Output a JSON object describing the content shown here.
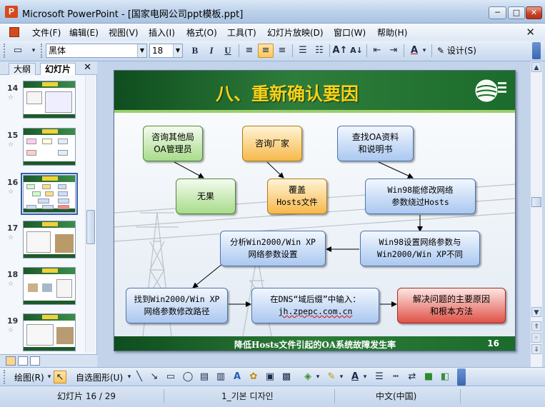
{
  "window": {
    "title": "Microsoft PowerPoint - [国家电网公司ppt模板.ppt]",
    "app_icon_letter": "P",
    "minimize": "─",
    "maximize": "□",
    "close": "✕"
  },
  "menu": {
    "items": [
      "文件(F)",
      "编辑(E)",
      "视图(V)",
      "插入(I)",
      "格式(O)",
      "工具(T)",
      "幻灯片放映(D)",
      "窗口(W)",
      "帮助(H)"
    ],
    "doc_close": "✕"
  },
  "toolbar": {
    "font_name": "黑体",
    "font_size": "18",
    "bold": "B",
    "italic": "I",
    "underline": "U",
    "design_label": "设计(S)"
  },
  "left_pane": {
    "tab_outline": "大纲",
    "tab_slides": "幻灯片",
    "close": "✕",
    "slides": [
      {
        "number": "14"
      },
      {
        "number": "15"
      },
      {
        "number": "16"
      },
      {
        "number": "17"
      },
      {
        "number": "18"
      },
      {
        "number": "19"
      }
    ]
  },
  "slide": {
    "title": "八、重新确认要因",
    "footer": "降低Hosts文件引起的OA系统故障发生率",
    "page": "16",
    "boxes": {
      "consult_other": [
        "咨询其他局",
        "OA管理员"
      ],
      "consult_vendor": [
        "咨询厂家"
      ],
      "find_docs": [
        "查找OA资料",
        "和说明书"
      ],
      "no_result": [
        "无果"
      ],
      "override_hosts": [
        "覆盖",
        "Hosts文件"
      ],
      "win98_modify": [
        "Win98能修改网络",
        "参数绕过Hosts"
      ],
      "analyze_win2000": [
        "分析Win2000/Win XP",
        "网络参数设置"
      ],
      "win98_diff": [
        "Win98设置网络参数与",
        "Win2000/Win XP不同"
      ],
      "find_path": [
        "找到Win2000/Win XP",
        "网络参数修改路径"
      ],
      "dns_input": [
        "在DNS“域后缀”中输入：",
        "jh.zpepc.com.cn"
      ],
      "root_cause": [
        "解决问题的主要原因",
        "和根本方法"
      ]
    }
  },
  "draw_toolbar": {
    "draw_label": "绘图(R)",
    "autoshape_label": "自选图形(U)"
  },
  "status": {
    "slide_pos": "幻灯片 16 / 29",
    "design": "1_기본 디자인",
    "language": "中文(中国)"
  },
  "colors": {
    "header_green": "#1b6b2c",
    "title_yellow": "#f5d21a",
    "box_green": "#a8dc8a",
    "box_orange": "#f6b94a",
    "box_blue": "#aac8f0",
    "box_red": "#e05248"
  }
}
